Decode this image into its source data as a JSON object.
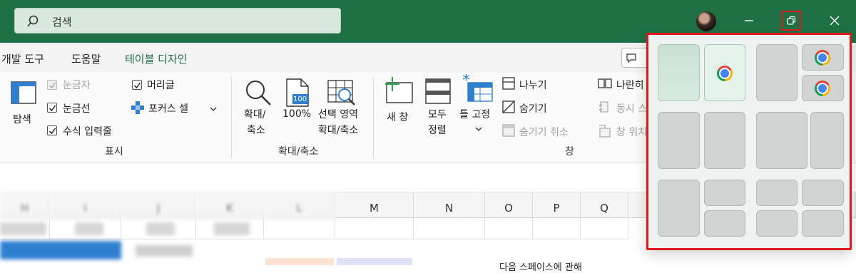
{
  "search": {
    "placeholder": "검색"
  },
  "menu": [
    "개발 도구",
    "도움말",
    "테이블 디자인"
  ],
  "ribbon": {
    "view": {
      "navigate": "탐색",
      "ruler": "눈금자",
      "gridlines": "눈금선",
      "formula_bar": "수식 입력줄",
      "headings": "머리글",
      "focus_cell": "포커스 셀",
      "group_label": "표시"
    },
    "zoom": {
      "zoom_line1": "확대/",
      "zoom_line2": "축소",
      "zoom100": "100%",
      "zoom100_icon_text": "100",
      "selection_line1": "선택 영역",
      "selection_line2": "확대/축소",
      "group_label": "확대/축소"
    },
    "window": {
      "new_window": "새 창",
      "arrange_line1": "모두",
      "arrange_line2": "정렬",
      "freeze": "틀 고정",
      "split": "나누기",
      "hide": "숨기기",
      "unhide": "숨기기 취소",
      "side_by_side": "나란히",
      "sync_scroll": "동시 스",
      "reset_position": "창 위치",
      "group_label": "창"
    },
    "comment_button": "□"
  },
  "columns": [
    "H",
    "I",
    "J",
    "K",
    "L",
    "M",
    "N",
    "O",
    "P",
    "Q"
  ],
  "grid": {
    "row3_text": "다음 스페이스에 관해"
  },
  "colors": {
    "title_bar": "#1e7145",
    "highlight": "#e0181c",
    "snap_bg": "#eef2f0"
  },
  "icons": [
    "search-icon",
    "minimize-icon",
    "restore-icon",
    "close-icon",
    "chrome-icon"
  ]
}
